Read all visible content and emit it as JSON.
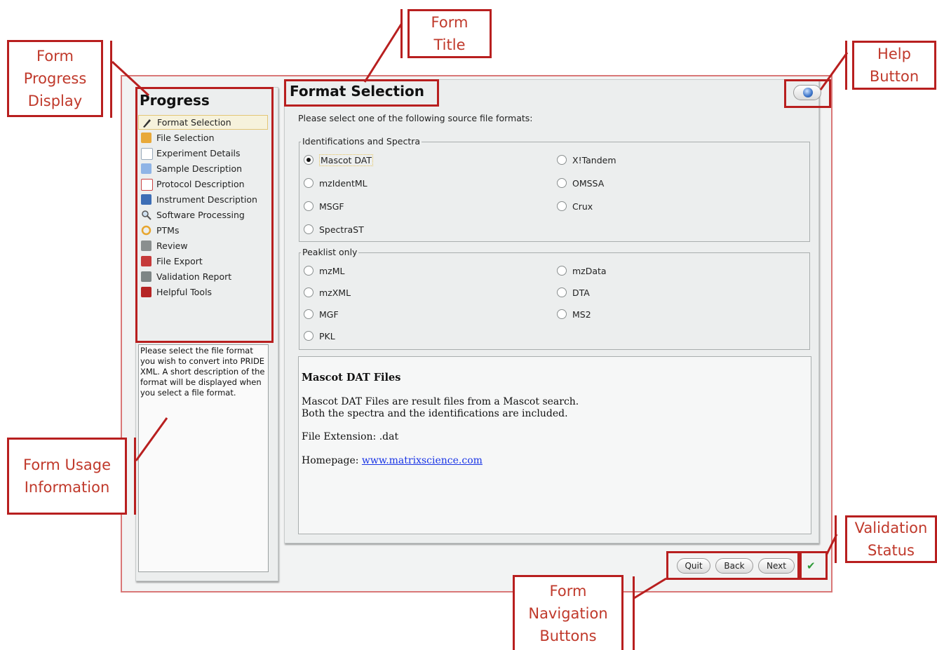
{
  "annotations": {
    "form_progress_display": "Form\nProgress\nDisplay",
    "form_title": "Form\nTitle",
    "help_button": "Help\nButton",
    "form_usage_information": "Form Usage\nInformation",
    "validation_status": "Validation\nStatus",
    "form_navigation_buttons": "Form\nNavigation\nButtons"
  },
  "sidebar": {
    "title": "Progress",
    "steps": [
      {
        "label": "Format Selection",
        "icon": "pencil-icon"
      },
      {
        "label": "File Selection",
        "icon": "files-icon"
      },
      {
        "label": "Experiment Details",
        "icon": "document-icon"
      },
      {
        "label": "Sample Description",
        "icon": "flask-icon"
      },
      {
        "label": "Protocol Description",
        "icon": "protocol-icon"
      },
      {
        "label": "Instrument Description",
        "icon": "instrument-icon"
      },
      {
        "label": "Software Processing",
        "icon": "magnifier-icon"
      },
      {
        "label": "PTMs",
        "icon": "ring-icon"
      },
      {
        "label": "Review",
        "icon": "review-icon"
      },
      {
        "label": "File Export",
        "icon": "export-icon"
      },
      {
        "label": "Validation Report",
        "icon": "validation-icon"
      },
      {
        "label": "Helpful Tools",
        "icon": "toolbox-icon"
      }
    ],
    "usage_text": "Please select the file format you wish to convert into PRIDE XML. A short description of the format will be displayed when you select a file format."
  },
  "main": {
    "title": "Format Selection",
    "instruction": "Please select one of the following source file formats:",
    "groups": {
      "identifications": {
        "label": "Identifications and Spectra",
        "options": [
          "Mascot DAT",
          "X!Tandem",
          "mzIdentML",
          "OMSSA",
          "MSGF",
          "Crux",
          "SpectraST"
        ]
      },
      "peaklist": {
        "label": "Peaklist only",
        "options": [
          "mzML",
          "mzData",
          "mzXML",
          "DTA",
          "MGF",
          "MS2",
          "PKL"
        ]
      }
    },
    "selected_format": "Mascot DAT",
    "description": {
      "title": "Mascot DAT Files",
      "line1": "Mascot DAT Files are result files from a Mascot search.",
      "line2": "Both the spectra and the identifications are included.",
      "extension": "File Extension: .dat",
      "homepage_label": "Homepage: ",
      "homepage_link": "www.matrixscience.com"
    }
  },
  "navigation": {
    "quit": "Quit",
    "back": "Back",
    "next": "Next",
    "validation_check": "✔"
  },
  "colors": {
    "annotation_red": "#b81f1f",
    "annotation_text": "#c0392b",
    "window_border": "#d97777",
    "link_blue": "#1a35e6",
    "check_green": "#2e9a38"
  }
}
